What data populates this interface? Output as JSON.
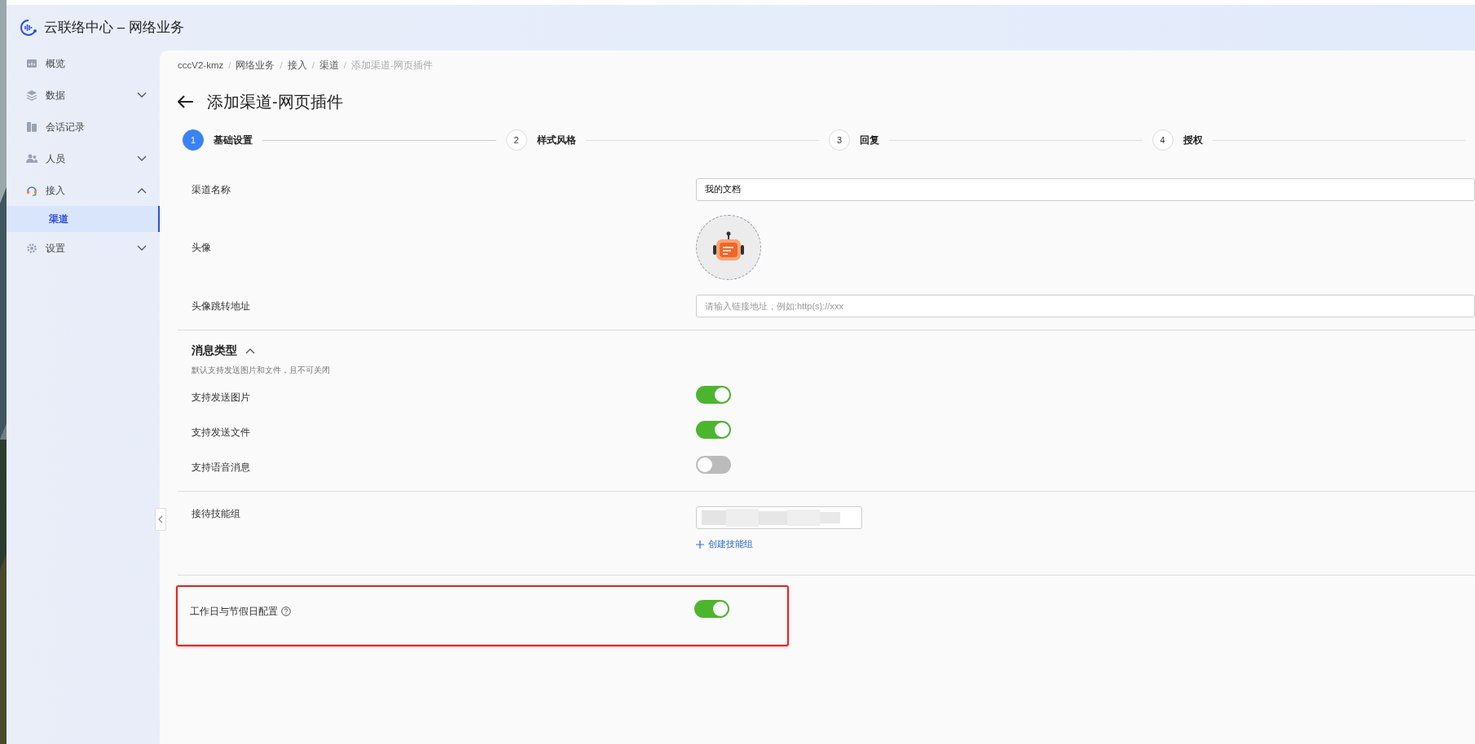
{
  "app": {
    "title": "云联络中心 – 网络业务"
  },
  "sidebar": {
    "items": [
      {
        "label": "概览",
        "kind": "link"
      },
      {
        "label": "数据",
        "kind": "group",
        "expanded": false
      },
      {
        "label": "会话记录",
        "kind": "link"
      },
      {
        "label": "人员",
        "kind": "group",
        "expanded": false
      },
      {
        "label": "接入",
        "kind": "group",
        "expanded": true,
        "children": [
          {
            "label": "渠道",
            "selected": true
          }
        ]
      },
      {
        "label": "设置",
        "kind": "group",
        "expanded": false
      }
    ]
  },
  "breadcrumb": {
    "separator": "/",
    "items": [
      "cccV2-kmz",
      "网络业务",
      "接入",
      "渠道",
      "添加渠道-网页插件"
    ]
  },
  "page": {
    "title": "添加渠道-网页插件"
  },
  "steps": [
    {
      "number": "1",
      "label": "基础设置",
      "selected": true
    },
    {
      "number": "2",
      "label": "样式风格",
      "selected": false
    },
    {
      "number": "3",
      "label": "回复",
      "selected": false
    },
    {
      "number": "4",
      "label": "授权",
      "selected": false
    }
  ],
  "form": {
    "groups": [
      {
        "rows": [
          {
            "kind": "input",
            "label": "渠道名称",
            "value": "我的文档"
          },
          {
            "kind": "avatar",
            "label": "头像"
          },
          {
            "kind": "input",
            "label": "头像跳转地址",
            "placeholder": "请输入链接地址，例如:http(s)://xxx"
          }
        ]
      },
      {
        "title": "消息类型",
        "expanded": true,
        "hint": "默认支持发送图片和文件，且不可关闭",
        "rows": [
          {
            "kind": "switch",
            "label": "支持发送图片",
            "on": true
          },
          {
            "kind": "switch",
            "label": "支持发送文件",
            "on": true
          },
          {
            "kind": "switch",
            "label": "支持语音消息",
            "on": false
          }
        ]
      },
      {
        "rows": [
          {
            "kind": "select",
            "label": "接待技能组",
            "link": "创建技能组"
          }
        ]
      },
      {
        "highlighted": true,
        "rows": [
          {
            "kind": "switch",
            "label": "工作日与节假日配置",
            "on": true,
            "help": true
          }
        ]
      }
    ]
  }
}
